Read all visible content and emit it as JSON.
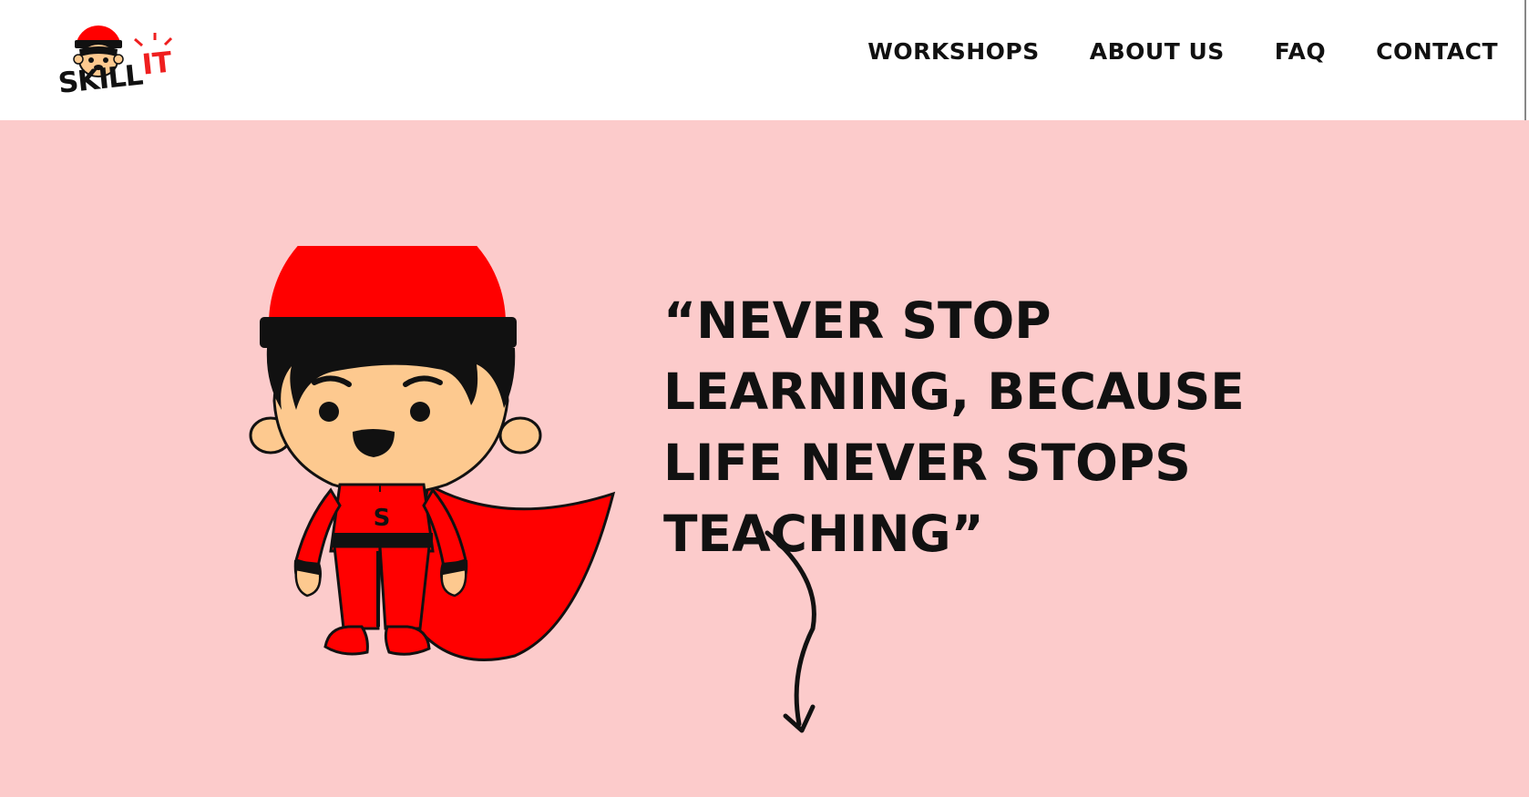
{
  "brand": {
    "name_part1": "SKILL",
    "name_part2": "IT",
    "accent": "#ef1f1f"
  },
  "nav": {
    "items": [
      {
        "label": "WORKSHOPS"
      },
      {
        "label": "ABOUT US"
      },
      {
        "label": "FAQ"
      },
      {
        "label": "CONTACT"
      }
    ]
  },
  "hero": {
    "quote": "“NEVER STOP LEARNING, BECAUSE LIFE NEVER STOPS TEACHING”",
    "background": "#fccbcb",
    "mascot_letter": "S",
    "mascot_colors": {
      "suit": "#ff0000",
      "skin": "#fdc98f",
      "hair": "#000000"
    }
  }
}
